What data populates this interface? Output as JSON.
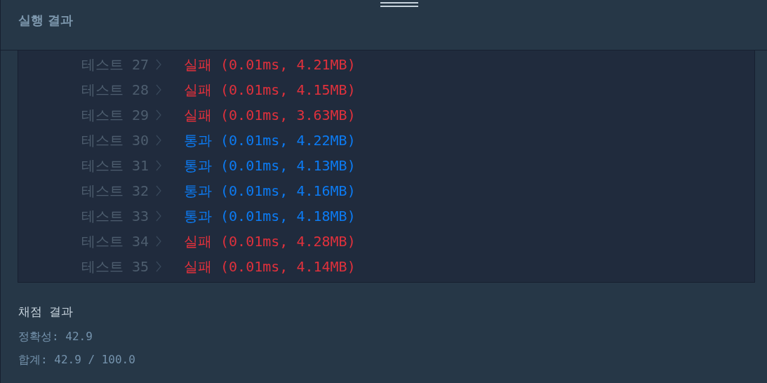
{
  "header": {
    "title": "실행 결과"
  },
  "results": [
    {
      "label": "테스트 27",
      "kind": "fail",
      "status": "실패",
      "detail": "(0.01ms, 4.21MB)"
    },
    {
      "label": "테스트 28",
      "kind": "fail",
      "status": "실패",
      "detail": "(0.01ms, 4.15MB)"
    },
    {
      "label": "테스트 29",
      "kind": "fail",
      "status": "실패",
      "detail": "(0.01ms, 3.63MB)"
    },
    {
      "label": "테스트 30",
      "kind": "pass",
      "status": "통과",
      "detail": "(0.01ms, 4.22MB)"
    },
    {
      "label": "테스트 31",
      "kind": "pass",
      "status": "통과",
      "detail": "(0.01ms, 4.13MB)"
    },
    {
      "label": "테스트 32",
      "kind": "pass",
      "status": "통과",
      "detail": "(0.01ms, 4.16MB)"
    },
    {
      "label": "테스트 33",
      "kind": "pass",
      "status": "통과",
      "detail": "(0.01ms, 4.18MB)"
    },
    {
      "label": "테스트 34",
      "kind": "fail",
      "status": "실패",
      "detail": "(0.01ms, 4.28MB)"
    },
    {
      "label": "테스트 35",
      "kind": "fail",
      "status": "실패",
      "detail": "(0.01ms, 4.14MB)"
    }
  ],
  "grading": {
    "title": "채점 결과",
    "accuracy": "정확성: 42.9",
    "total": "합계: 42.9 / 100.0"
  }
}
